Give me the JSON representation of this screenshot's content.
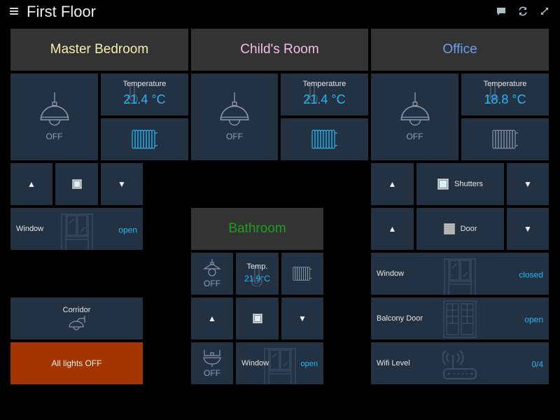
{
  "topbar": {
    "title": "First Floor",
    "icons": [
      "menu-icon",
      "chat-icon",
      "refresh-icon",
      "fullscreen-icon"
    ]
  },
  "colors": {
    "tile_bg": "#223243",
    "header_bg": "#333333",
    "accent_value": "#29b6f6",
    "alert_bg": "#a33600",
    "master_bedroom": "#f4f0b0",
    "childs_room": "#f2bfe8",
    "office": "#6d9ef0",
    "bathroom": "#1f9e1f"
  },
  "rooms": {
    "master_bedroom": {
      "title": "Master Bedroom",
      "light": {
        "state": "OFF"
      },
      "temperature": {
        "label": "Temperature",
        "value": "21.4 °C"
      },
      "heating": {
        "active": true
      },
      "shutter": {
        "up": "▲",
        "down": "▼"
      },
      "window": {
        "label": "Window",
        "state": "open"
      }
    },
    "childs_room": {
      "title": "Child's Room",
      "light": {
        "state": "OFF"
      },
      "temperature": {
        "label": "Temperature",
        "value": "21.4 °C"
      },
      "heating": {
        "active": true
      }
    },
    "office": {
      "title": "Office",
      "light": {
        "state": "OFF"
      },
      "temperature": {
        "label": "Temperature",
        "value": "18.8 °C"
      },
      "heating": {
        "active": false
      },
      "shutters": {
        "label": "Shutters",
        "up": "▲",
        "down": "▼"
      },
      "door": {
        "label": "Door",
        "up": "▲",
        "down": "▼"
      },
      "window": {
        "label": "Window",
        "state": "closed"
      },
      "balcony_door": {
        "label": "Balcony Door",
        "state": "open"
      },
      "wifi": {
        "label": "Wifi Level",
        "value": "0/4"
      }
    },
    "bathroom": {
      "title": "Bathroom",
      "light": {
        "state": "OFF"
      },
      "temperature": {
        "label": "Temp.",
        "value": "21.9°C"
      },
      "heating": {
        "active": false
      },
      "shutter": {
        "up": "▲",
        "down": "▼"
      },
      "sink_light": {
        "state": "OFF"
      },
      "window": {
        "label": "Window",
        "state": "open"
      }
    }
  },
  "corridor": {
    "label": "Corridor"
  },
  "all_lights": {
    "label": "All lights OFF"
  }
}
